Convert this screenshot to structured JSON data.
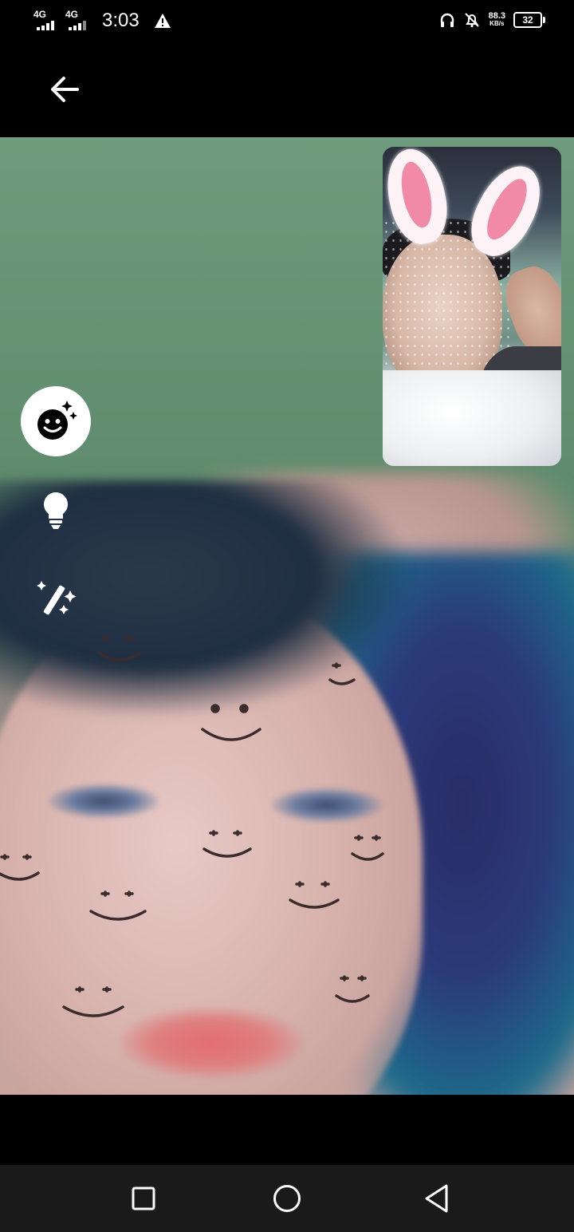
{
  "status_bar": {
    "network_1": "4G",
    "network_2": "4G",
    "time": "3:03",
    "speed_value": "88.3",
    "speed_unit": "KB/s",
    "battery": "32",
    "icons": [
      "signal-icon",
      "signal-icon",
      "warning-icon",
      "headphones-icon",
      "bell-off-icon",
      "battery-icon"
    ]
  },
  "header": {
    "back_icon": "arrow-left-icon"
  },
  "call": {
    "remote_video": "remote-participant-video",
    "self_view": "self-view-video",
    "tools": [
      "effects-icon",
      "lightbulb-icon",
      "magic-wand-icon"
    ]
  },
  "nav": {
    "icons": [
      "recent-apps-icon",
      "home-icon",
      "back-triangle-icon"
    ]
  },
  "colors": {
    "nav_bar": "#1a1a1a",
    "background": "#000000",
    "icon": "#ffffff"
  }
}
